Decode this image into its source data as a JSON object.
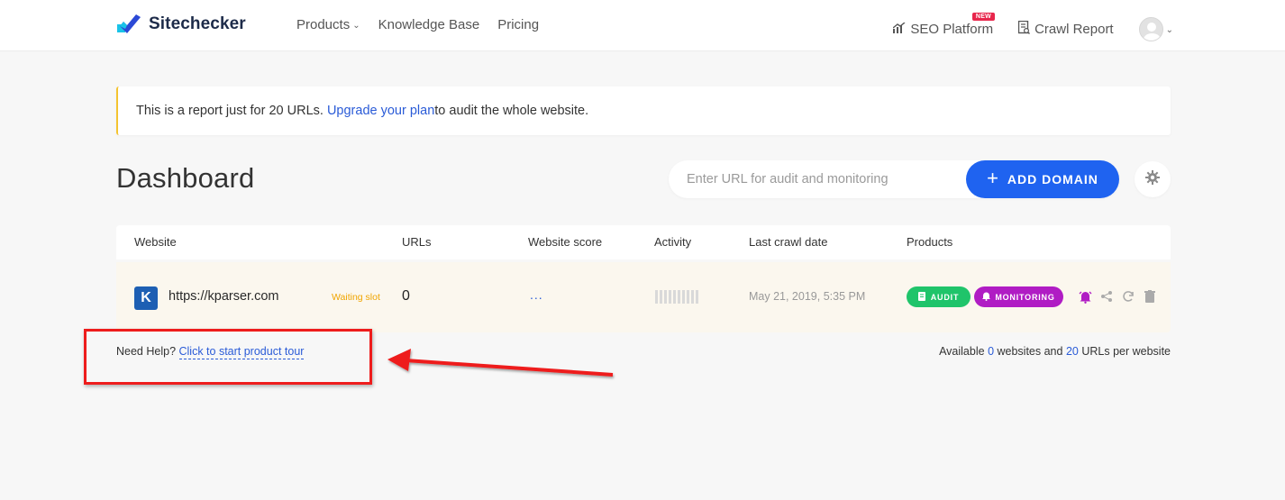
{
  "header": {
    "brand": "Sitechecker",
    "nav": [
      {
        "label": "Products",
        "has_dropdown": true
      },
      {
        "label": "Knowledge Base"
      },
      {
        "label": "Pricing"
      }
    ],
    "right_nav": [
      {
        "label": "SEO Platform",
        "badge": "NEW",
        "icon": "bar-chart-icon"
      },
      {
        "label": "Crawl Report",
        "icon": "report-icon"
      }
    ]
  },
  "notice": {
    "text_before": "This is a report just for 20 URLs.",
    "link": "Upgrade your plan",
    "text_after": " to audit the whole website."
  },
  "dashboard": {
    "title": "Dashboard",
    "search_placeholder": "Enter URL for audit and monitoring",
    "add_button": "ADD DOMAIN"
  },
  "table": {
    "headers": [
      "Website",
      "URLs",
      "Website score",
      "Activity",
      "Last crawl date",
      "Products"
    ],
    "rows": [
      {
        "badge": "K",
        "url": "https://kparser.com",
        "status": "Waiting slot",
        "urls": "0",
        "score": "...",
        "last_crawl": "May 21, 2019, 5:35 PM",
        "products": [
          "AUDIT",
          "MONITORING"
        ]
      }
    ]
  },
  "help": {
    "text": "Need Help?",
    "link": "Click to start product tour"
  },
  "available": {
    "prefix": "Available",
    "websites": "0",
    "middle": "websites and",
    "urls": "20",
    "suffix": "URLs per website"
  },
  "colors": {
    "accent": "#1f63f0",
    "audit": "#1fc46a",
    "monitoring": "#b01cc4",
    "annotation": "#ee1c1c",
    "notice_border": "#f4c430"
  }
}
